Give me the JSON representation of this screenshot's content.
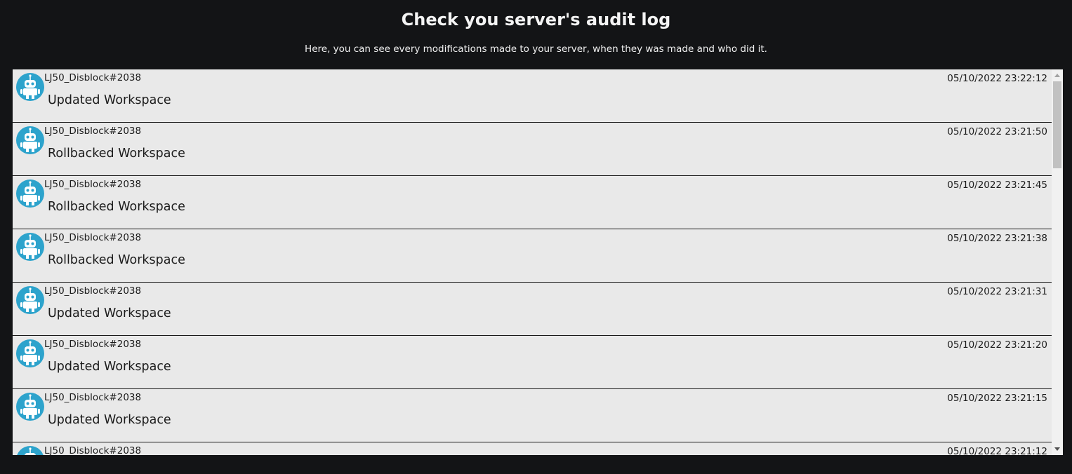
{
  "header": {
    "title": "Check you server's audit log",
    "subtitle": "Here, you can see every modifications made to your server, when they was made and who did it."
  },
  "colors": {
    "background": "#131416",
    "panel": "#e9e9e9",
    "avatar": "#2da3cc",
    "text_dark": "#1c1c1c"
  },
  "entries": [
    {
      "user": "LJ50_Disblock#2038",
      "time": "05/10/2022 23:22:12",
      "action": "Updated Workspace",
      "icon": "robot-icon"
    },
    {
      "user": "LJ50_Disblock#2038",
      "time": "05/10/2022 23:21:50",
      "action": "Rollbacked Workspace",
      "icon": "robot-icon"
    },
    {
      "user": "LJ50_Disblock#2038",
      "time": "05/10/2022 23:21:45",
      "action": "Rollbacked Workspace",
      "icon": "robot-icon"
    },
    {
      "user": "LJ50_Disblock#2038",
      "time": "05/10/2022 23:21:38",
      "action": "Rollbacked Workspace",
      "icon": "robot-icon"
    },
    {
      "user": "LJ50_Disblock#2038",
      "time": "05/10/2022 23:21:31",
      "action": "Updated Workspace",
      "icon": "robot-icon"
    },
    {
      "user": "LJ50_Disblock#2038",
      "time": "05/10/2022 23:21:20",
      "action": "Updated Workspace",
      "icon": "robot-icon"
    },
    {
      "user": "LJ50_Disblock#2038",
      "time": "05/10/2022 23:21:15",
      "action": "Updated Workspace",
      "icon": "robot-icon"
    },
    {
      "user": "LJ50_Disblock#2038",
      "time": "05/10/2022 23:21:12",
      "action": "",
      "icon": "robot-icon"
    }
  ]
}
